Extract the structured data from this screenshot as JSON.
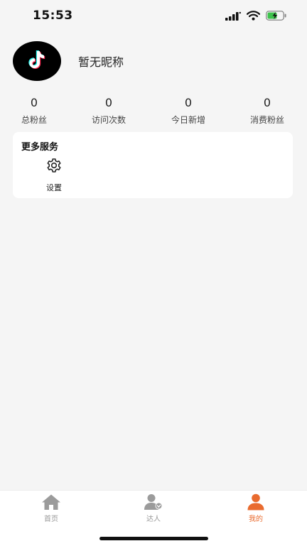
{
  "status_bar": {
    "time": "15:53"
  },
  "profile": {
    "nickname": "暂无昵称"
  },
  "stats": [
    {
      "value": "0",
      "label": "总粉丝"
    },
    {
      "value": "0",
      "label": "访问次数"
    },
    {
      "value": "0",
      "label": "今日新增"
    },
    {
      "value": "0",
      "label": "消费粉丝"
    }
  ],
  "services": {
    "title": "更多服务",
    "items": [
      {
        "label": "设置",
        "icon": "gear-icon"
      }
    ]
  },
  "tab_bar": {
    "tabs": [
      {
        "label": "首页",
        "icon": "home-icon"
      },
      {
        "label": "达人",
        "icon": "person-check-icon"
      },
      {
        "label": "我的",
        "icon": "person-icon",
        "active": true
      }
    ]
  },
  "colors": {
    "accent": "#e96b2f",
    "inactive": "#999999",
    "background": "#f5f5f5"
  }
}
